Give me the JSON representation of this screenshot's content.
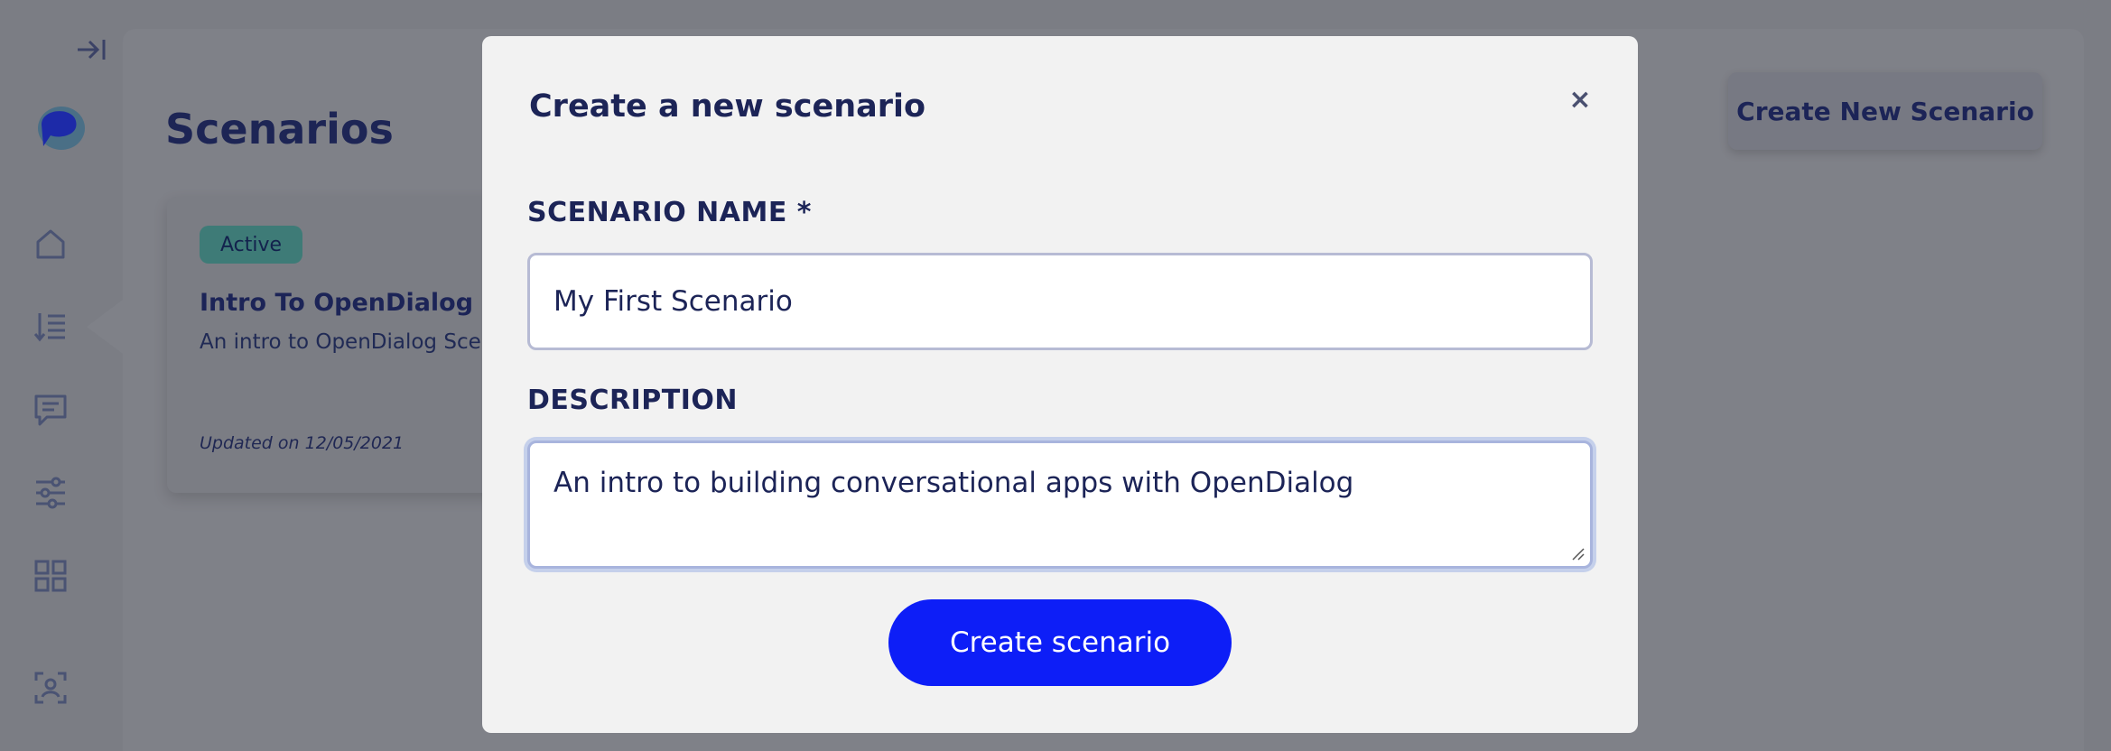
{
  "sidebar": {
    "items": [
      {
        "icon": "home-icon"
      },
      {
        "icon": "scenarios-list-icon",
        "active": true
      },
      {
        "icon": "conversation-icon"
      },
      {
        "icon": "sliders-icon"
      },
      {
        "icon": "apps-grid-icon"
      },
      {
        "icon": "scan-icon"
      }
    ]
  },
  "page": {
    "title": "Scenarios",
    "header_button_label": "Create New Scenario"
  },
  "card": {
    "status": "Active",
    "title": "Intro To OpenDialog",
    "description": "An intro to OpenDialog Scenarios",
    "updated": "Updated on 12/05/2021"
  },
  "modal": {
    "title": "Create a new scenario",
    "close_label": "×",
    "name_label": "SCENARIO NAME *",
    "name_value": "My First Scenario",
    "description_label": "DESCRIPTION",
    "description_value": "An intro to building conversational apps with OpenDialog",
    "submit_label": "Create scenario"
  },
  "colors": {
    "primary": "#0d1ef7",
    "overlay": "#7b7d84",
    "text_dark": "#1c2457",
    "active_badge": "#3e7b77"
  }
}
